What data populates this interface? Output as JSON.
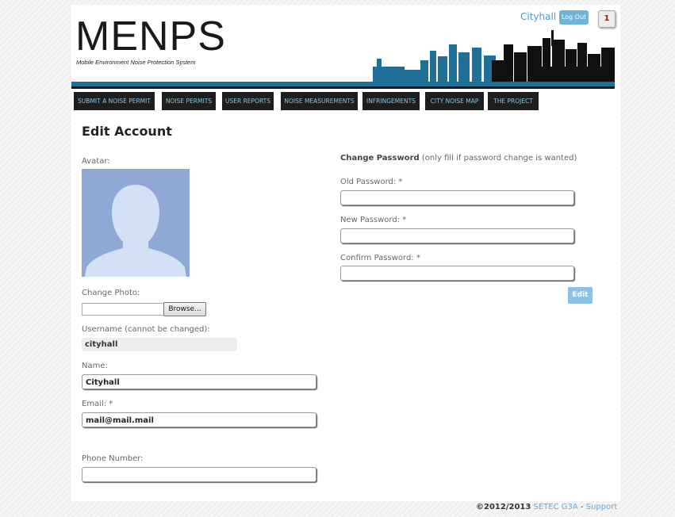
{
  "header": {
    "logo": "MENPS",
    "subtitle": "Mobile Environment Noise Protection System",
    "user": "Cityhall",
    "logout_label": "Log Out",
    "notification_count": "1"
  },
  "nav": {
    "items": [
      {
        "label": "SUBMIT A NOISE PERMIT"
      },
      {
        "label": "NOISE PERMITS"
      },
      {
        "label": "USER REPORTS"
      },
      {
        "label": "NOISE MEASUREMENTS"
      },
      {
        "label": "INFRINGEMENTS"
      },
      {
        "label": "CITY NOISE MAP"
      },
      {
        "label": "THE PROJECT"
      }
    ]
  },
  "form": {
    "title": "Edit Account",
    "avatar_label": "Avatar:",
    "change_photo_label": "Change Photo:",
    "browse_label": "Browse...",
    "username_label": "Username (cannot be changed):",
    "username_value": "cityhall",
    "name_label": "Name:",
    "name_value": "Cityhall",
    "email_label": "Email: *",
    "email_value": "mail@mail.mail",
    "phone_label": "Phone Number:",
    "phone_value": "",
    "change_password_title": "Change Password",
    "change_password_note": "(only fill if password change is wanted)",
    "old_password_label": "Old Password: *",
    "new_password_label": "New Password: *",
    "confirm_password_label": "Confirm Password: *",
    "edit_label": "Edit"
  },
  "footer": {
    "copyright": "©2012/2013",
    "org": "SETEC G3A",
    "separator": "-",
    "support": "Support"
  },
  "colors": {
    "accent": "#4a9bd4",
    "nav_bg": "#1e1e1e",
    "nav_text": "#8ac6e6",
    "header_bar": "#1f6f96",
    "button": "#8cc3e3"
  }
}
